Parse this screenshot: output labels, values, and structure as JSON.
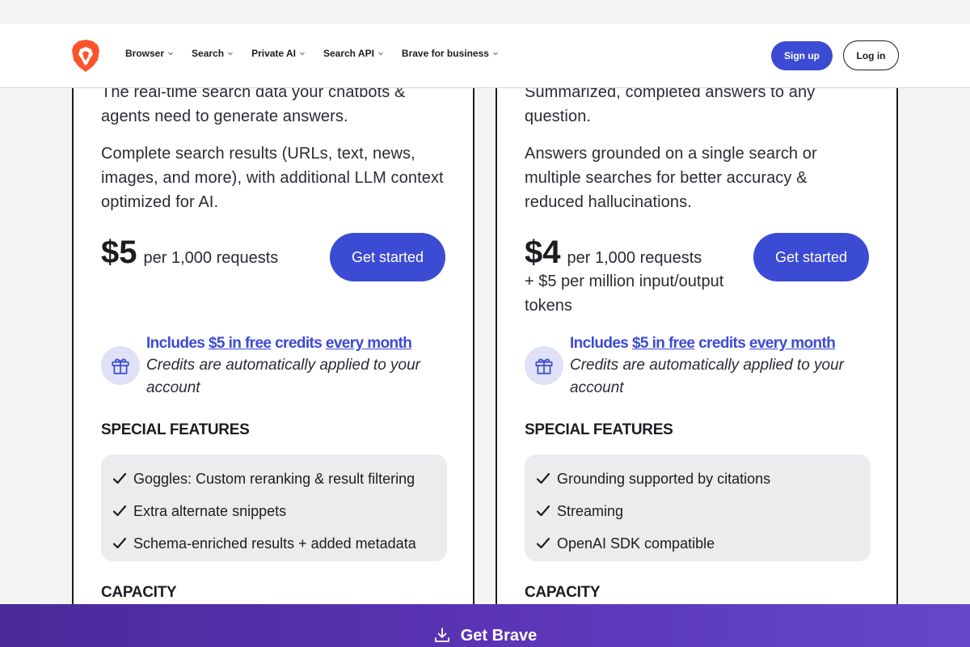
{
  "nav": {
    "items": [
      {
        "label": "Browser"
      },
      {
        "label": "Search"
      },
      {
        "label": "Private AI"
      },
      {
        "label": "Search API"
      },
      {
        "label": "Brave for business"
      }
    ],
    "signup": "Sign up",
    "login": "Log in"
  },
  "plans": [
    {
      "intro": "The real-time search data your chatbots & agents need to generate answers.",
      "description": "Complete search results (URLs, text, news, images, and more), with additional LLM context optimized for AI.",
      "price": "$5",
      "price_unit": "per 1,000 requests",
      "price_extra": "",
      "cta": "Get started",
      "credits": {
        "a": "Includes ",
        "b": "$5 in free",
        "c": " credits ",
        "d": "every month",
        "note": "Credits are automatically applied to your account"
      },
      "special_features_heading": "SPECIAL FEATURES",
      "features": [
        "Goggles: Custom reranking & result filtering",
        "Extra alternate snippets",
        "Schema-enriched results + added metadata"
      ],
      "capacity_heading": "CAPACITY"
    },
    {
      "intro": "Summarized, completed answers to any question.",
      "description": "Answers grounded on a single search or multiple searches for better accuracy & reduced hallucinations.",
      "price": "$4",
      "price_unit": "per 1,000 requests",
      "price_extra": "+ $5 per million input/output tokens",
      "cta": "Get started",
      "credits": {
        "a": "Includes ",
        "b": "$5 in free",
        "c": " credits ",
        "d": "every month",
        "note": "Credits are automatically applied to your account"
      },
      "special_features_heading": "SPECIAL FEATURES",
      "features": [
        "Grounding supported by citations",
        "Streaming",
        "OpenAI SDK compatible"
      ],
      "capacity_heading": "CAPACITY"
    }
  ],
  "footer_cta": "Get Brave",
  "colors": {
    "accent": "#3c4bd4",
    "brand_orange": "#fb542b",
    "banner": "#5a34b4"
  }
}
